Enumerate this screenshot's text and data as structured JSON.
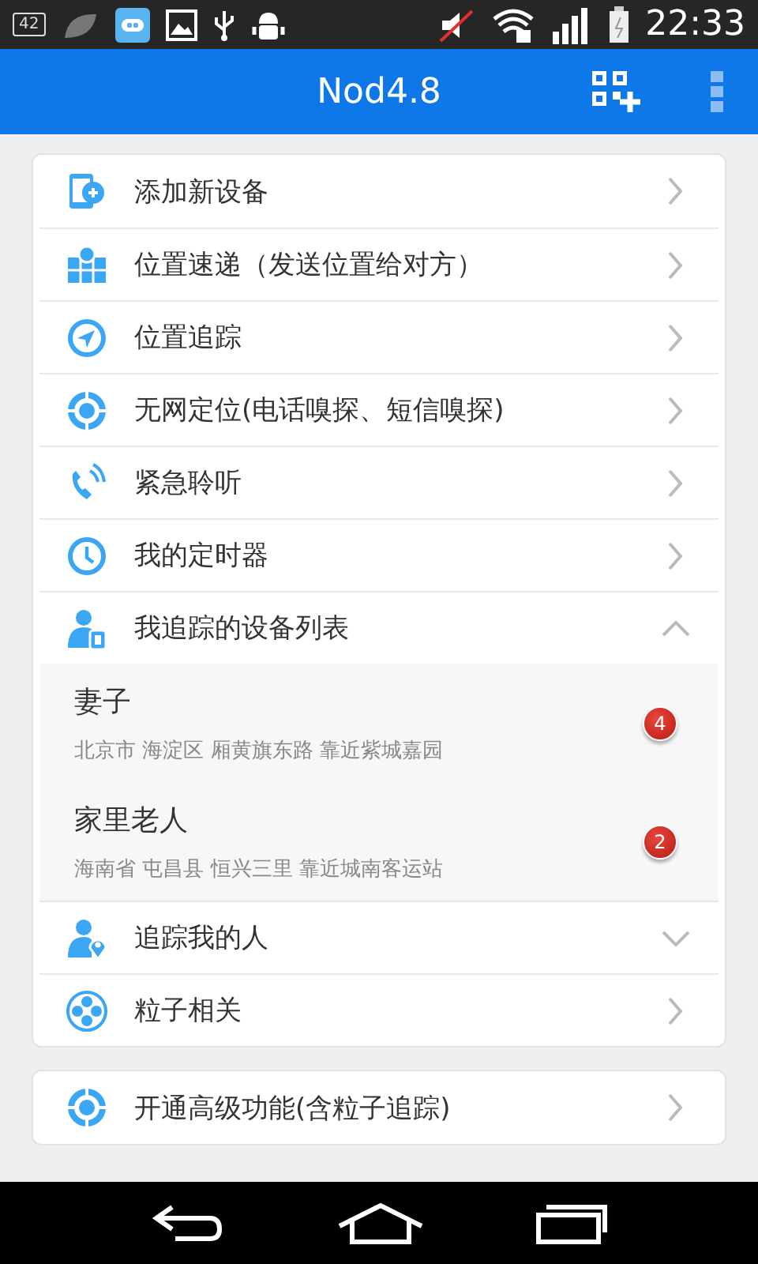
{
  "status_bar": {
    "badge": "42",
    "time": "22:33"
  },
  "app_bar": {
    "title": "Nod4.8"
  },
  "menu": [
    {
      "kind": "link",
      "label": "添加新设备"
    },
    {
      "kind": "link",
      "label": "位置速递（发送位置给对方）"
    },
    {
      "kind": "link",
      "label": "位置追踪"
    },
    {
      "kind": "link",
      "label": "无网定位(电话嗅探、短信嗅探)"
    },
    {
      "kind": "link",
      "label": "紧急聆听"
    },
    {
      "kind": "link",
      "label": "我的定时器"
    },
    {
      "kind": "group",
      "label": "我追踪的设备列表",
      "expanded": true,
      "children": [
        {
          "name": "妻子",
          "address": "北京市 海淀区 厢黄旗东路 靠近紫城嘉园",
          "count": "4"
        },
        {
          "name": "家里老人",
          "address": "海南省 屯昌县 恒兴三里 靠近城南客运站",
          "count": "2"
        }
      ]
    },
    {
      "kind": "group",
      "label": "追踪我的人",
      "expanded": false
    },
    {
      "kind": "link",
      "label": "粒子相关"
    }
  ],
  "extra_menu": [
    {
      "kind": "link",
      "label": "开通高级功能(含粒子追踪)"
    }
  ]
}
